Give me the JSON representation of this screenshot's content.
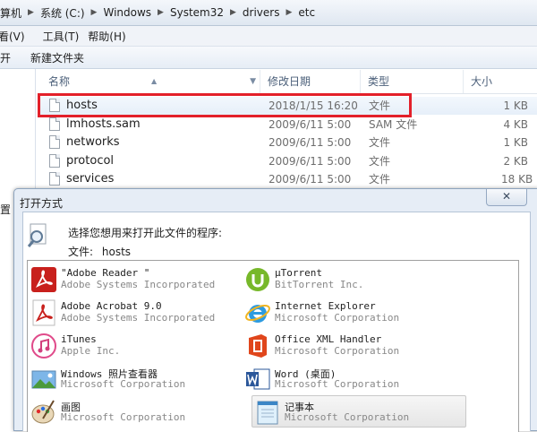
{
  "address_bar": {
    "crumbs": [
      "算机",
      "系统 (C:)",
      "Windows",
      "System32",
      "drivers",
      "etc"
    ]
  },
  "menu": {
    "items": [
      "看(V)",
      "工具(T)",
      "帮助(H)"
    ]
  },
  "toolbar": {
    "open_label": "开",
    "new_folder_label": "新建文件夹"
  },
  "nav": {
    "partial_text": "置"
  },
  "file_list": {
    "columns": [
      "名称",
      "修改日期",
      "类型",
      "大小"
    ],
    "rows": [
      {
        "name": "hosts",
        "date": "2018/1/15 16:20",
        "type": "文件",
        "size": "1 KB"
      },
      {
        "name": "lmhosts.sam",
        "date": "2009/6/11 5:00",
        "type": "SAM 文件",
        "size": "4 KB"
      },
      {
        "name": "networks",
        "date": "2009/6/11 5:00",
        "type": "文件",
        "size": "1 KB"
      },
      {
        "name": "protocol",
        "date": "2009/6/11 5:00",
        "type": "文件",
        "size": "2 KB"
      },
      {
        "name": "services",
        "date": "2009/6/11 5:00",
        "type": "文件",
        "size": "18 KB"
      }
    ]
  },
  "dialog": {
    "title": "打开方式",
    "close_label": "✕",
    "prompt": "选择您想用来打开此文件的程序:",
    "file_label": "文件:",
    "file_name": "hosts",
    "programs": [
      {
        "name": "\"Adobe Reader \"",
        "vendor": "Adobe Systems Incorporated",
        "icon": "adobe-reader-icon"
      },
      {
        "name": "μTorrent",
        "vendor": "BitTorrent Inc.",
        "icon": "utorrent-icon"
      },
      {
        "name": "Adobe Acrobat 9.0",
        "vendor": "Adobe Systems Incorporated",
        "icon": "adobe-acrobat-icon"
      },
      {
        "name": "Internet Explorer",
        "vendor": "Microsoft Corporation",
        "icon": "internet-explorer-icon"
      },
      {
        "name": "iTunes",
        "vendor": "Apple Inc.",
        "icon": "itunes-icon"
      },
      {
        "name": "Office XML Handler",
        "vendor": "Microsoft Corporation",
        "icon": "office-icon"
      },
      {
        "name": "Windows 照片查看器",
        "vendor": "Microsoft Corporation",
        "icon": "photo-viewer-icon"
      },
      {
        "name": "Word (桌面)",
        "vendor": "Microsoft Corporation",
        "icon": "word-icon"
      },
      {
        "name": "画图",
        "vendor": "Microsoft Corporation",
        "icon": "paint-icon"
      },
      {
        "name": "记事本",
        "vendor": "Microsoft Corporation",
        "icon": "notepad-icon"
      }
    ]
  },
  "colors": {
    "highlight_border": "#e3202a",
    "utorrent_green": "#77b82a",
    "adobe_red": "#c8201c"
  }
}
